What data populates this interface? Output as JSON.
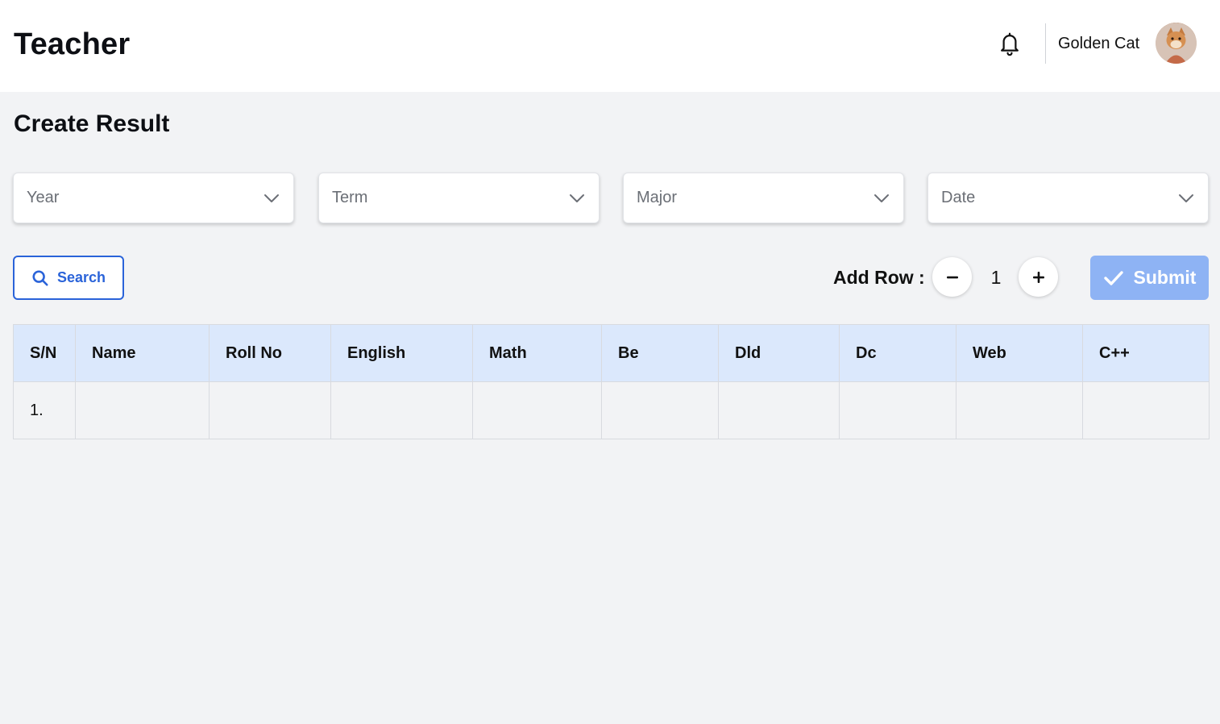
{
  "header": {
    "title": "Teacher",
    "user_name": "Golden Cat",
    "icons": {
      "notifications": "bell-icon",
      "avatar": "user-avatar"
    }
  },
  "page": {
    "title": "Create Result"
  },
  "filters": [
    {
      "placeholder": "Year",
      "icon": "chevron-down-icon"
    },
    {
      "placeholder": "Term",
      "icon": "chevron-down-icon"
    },
    {
      "placeholder": "Major",
      "icon": "chevron-down-icon"
    },
    {
      "placeholder": "Date",
      "icon": "chevron-down-icon"
    }
  ],
  "toolbar": {
    "search_label": "Search",
    "add_row_label": "Add Row :",
    "row_count": "1",
    "submit_label": "Submit"
  },
  "colors": {
    "primary": "#2a63d9",
    "submit_disabled": "#8eb3f4",
    "table_header_bg": "#dbe8fc",
    "page_bg": "#f2f3f5"
  },
  "table": {
    "columns": [
      "S/N",
      "Name",
      "Roll No",
      "English",
      "Math",
      "Be",
      "Dld",
      "Dc",
      "Web",
      "C++"
    ],
    "rows": [
      {
        "sn": "1.",
        "cells": [
          "",
          "",
          "",
          "",
          "",
          "",
          "",
          "",
          ""
        ]
      }
    ]
  }
}
